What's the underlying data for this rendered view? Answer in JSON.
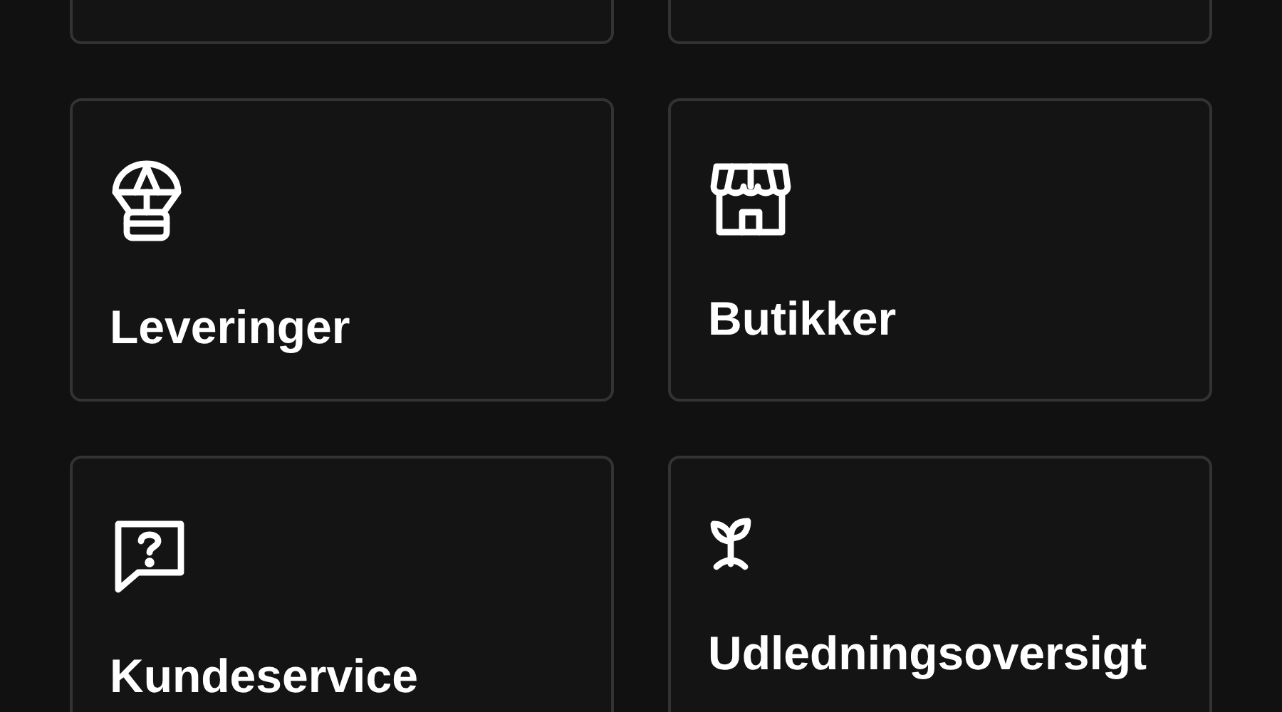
{
  "cards": [
    {
      "label": "Leveringer",
      "kind": "parachute"
    },
    {
      "label": "Butikker",
      "kind": "store"
    },
    {
      "label": "Kundeservice",
      "kind": "help"
    },
    {
      "label": "Udledningsoversigt",
      "kind": "sprout"
    }
  ]
}
